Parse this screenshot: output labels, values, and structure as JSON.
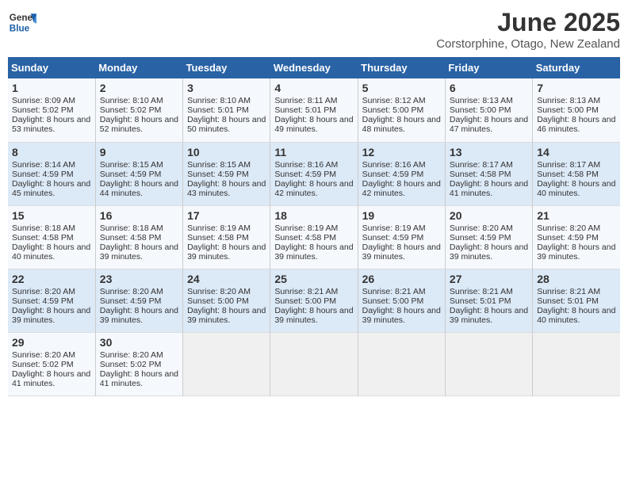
{
  "header": {
    "logo_line1": "General",
    "logo_line2": "Blue",
    "month_year": "June 2025",
    "location": "Corstorphine, Otago, New Zealand"
  },
  "days_of_week": [
    "Sunday",
    "Monday",
    "Tuesday",
    "Wednesday",
    "Thursday",
    "Friday",
    "Saturday"
  ],
  "weeks": [
    [
      {
        "day": 1,
        "sunrise": "8:09 AM",
        "sunset": "5:02 PM",
        "daylight": "8 hours and 53 minutes."
      },
      {
        "day": 2,
        "sunrise": "8:10 AM",
        "sunset": "5:02 PM",
        "daylight": "8 hours and 52 minutes."
      },
      {
        "day": 3,
        "sunrise": "8:10 AM",
        "sunset": "5:01 PM",
        "daylight": "8 hours and 50 minutes."
      },
      {
        "day": 4,
        "sunrise": "8:11 AM",
        "sunset": "5:01 PM",
        "daylight": "8 hours and 49 minutes."
      },
      {
        "day": 5,
        "sunrise": "8:12 AM",
        "sunset": "5:00 PM",
        "daylight": "8 hours and 48 minutes."
      },
      {
        "day": 6,
        "sunrise": "8:13 AM",
        "sunset": "5:00 PM",
        "daylight": "8 hours and 47 minutes."
      },
      {
        "day": 7,
        "sunrise": "8:13 AM",
        "sunset": "5:00 PM",
        "daylight": "8 hours and 46 minutes."
      }
    ],
    [
      {
        "day": 8,
        "sunrise": "8:14 AM",
        "sunset": "4:59 PM",
        "daylight": "8 hours and 45 minutes."
      },
      {
        "day": 9,
        "sunrise": "8:15 AM",
        "sunset": "4:59 PM",
        "daylight": "8 hours and 44 minutes."
      },
      {
        "day": 10,
        "sunrise": "8:15 AM",
        "sunset": "4:59 PM",
        "daylight": "8 hours and 43 minutes."
      },
      {
        "day": 11,
        "sunrise": "8:16 AM",
        "sunset": "4:59 PM",
        "daylight": "8 hours and 42 minutes."
      },
      {
        "day": 12,
        "sunrise": "8:16 AM",
        "sunset": "4:59 PM",
        "daylight": "8 hours and 42 minutes."
      },
      {
        "day": 13,
        "sunrise": "8:17 AM",
        "sunset": "4:58 PM",
        "daylight": "8 hours and 41 minutes."
      },
      {
        "day": 14,
        "sunrise": "8:17 AM",
        "sunset": "4:58 PM",
        "daylight": "8 hours and 40 minutes."
      }
    ],
    [
      {
        "day": 15,
        "sunrise": "8:18 AM",
        "sunset": "4:58 PM",
        "daylight": "8 hours and 40 minutes."
      },
      {
        "day": 16,
        "sunrise": "8:18 AM",
        "sunset": "4:58 PM",
        "daylight": "8 hours and 39 minutes."
      },
      {
        "day": 17,
        "sunrise": "8:19 AM",
        "sunset": "4:58 PM",
        "daylight": "8 hours and 39 minutes."
      },
      {
        "day": 18,
        "sunrise": "8:19 AM",
        "sunset": "4:58 PM",
        "daylight": "8 hours and 39 minutes."
      },
      {
        "day": 19,
        "sunrise": "8:19 AM",
        "sunset": "4:59 PM",
        "daylight": "8 hours and 39 minutes."
      },
      {
        "day": 20,
        "sunrise": "8:20 AM",
        "sunset": "4:59 PM",
        "daylight": "8 hours and 39 minutes."
      },
      {
        "day": 21,
        "sunrise": "8:20 AM",
        "sunset": "4:59 PM",
        "daylight": "8 hours and 39 minutes."
      }
    ],
    [
      {
        "day": 22,
        "sunrise": "8:20 AM",
        "sunset": "4:59 PM",
        "daylight": "8 hours and 39 minutes."
      },
      {
        "day": 23,
        "sunrise": "8:20 AM",
        "sunset": "4:59 PM",
        "daylight": "8 hours and 39 minutes."
      },
      {
        "day": 24,
        "sunrise": "8:20 AM",
        "sunset": "5:00 PM",
        "daylight": "8 hours and 39 minutes."
      },
      {
        "day": 25,
        "sunrise": "8:21 AM",
        "sunset": "5:00 PM",
        "daylight": "8 hours and 39 minutes."
      },
      {
        "day": 26,
        "sunrise": "8:21 AM",
        "sunset": "5:00 PM",
        "daylight": "8 hours and 39 minutes."
      },
      {
        "day": 27,
        "sunrise": "8:21 AM",
        "sunset": "5:01 PM",
        "daylight": "8 hours and 39 minutes."
      },
      {
        "day": 28,
        "sunrise": "8:21 AM",
        "sunset": "5:01 PM",
        "daylight": "8 hours and 40 minutes."
      }
    ],
    [
      {
        "day": 29,
        "sunrise": "8:20 AM",
        "sunset": "5:02 PM",
        "daylight": "8 hours and 41 minutes."
      },
      {
        "day": 30,
        "sunrise": "8:20 AM",
        "sunset": "5:02 PM",
        "daylight": "8 hours and 41 minutes."
      },
      null,
      null,
      null,
      null,
      null
    ]
  ]
}
